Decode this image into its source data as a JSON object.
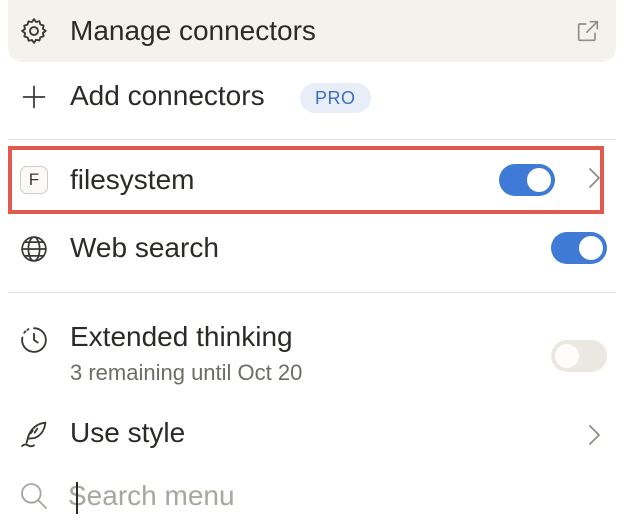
{
  "menu": {
    "manage_connectors": {
      "label": "Manage connectors",
      "icon": "gear-icon",
      "trailing_icon": "external-link-icon"
    },
    "add_connectors": {
      "label": "Add connectors",
      "icon": "plus-icon",
      "badge": "PRO"
    },
    "connectors": [
      {
        "label": "filesystem",
        "badge_letter": "F",
        "enabled": true,
        "highlighted": true,
        "highlight_color": "#e05a4e"
      },
      {
        "label": "Web search",
        "icon": "globe-icon",
        "enabled": true
      }
    ],
    "extended_thinking": {
      "label": "Extended thinking",
      "sublabel": "3 remaining until Oct 20",
      "icon": "clock-icon",
      "enabled": false
    },
    "use_style": {
      "label": "Use style",
      "icon": "quill-icon"
    },
    "search": {
      "placeholder": "Search menu",
      "value": ""
    }
  },
  "colors": {
    "accent": "#3f7bd6",
    "pro_badge_text": "#3b6ec4",
    "pro_badge_bg": "#e8eef8",
    "highlight": "#e05a4e"
  }
}
